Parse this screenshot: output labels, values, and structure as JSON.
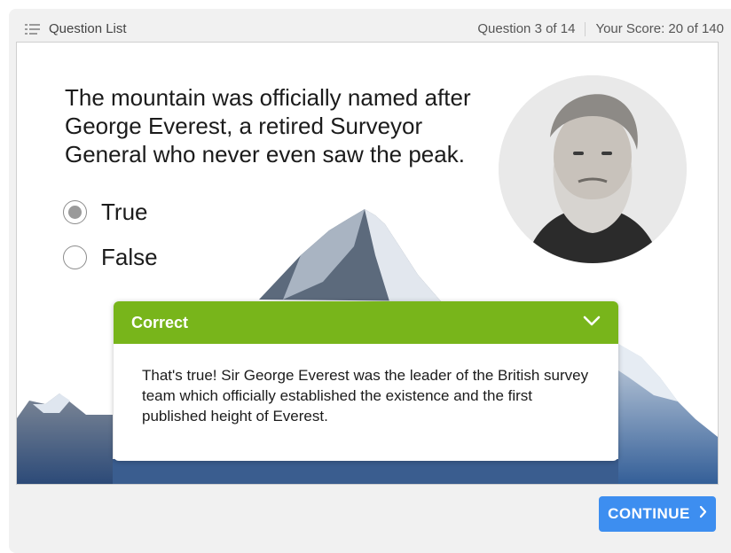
{
  "topbar": {
    "question_list_icon": "list-icon",
    "question_list_label": "Question List",
    "question_counter": "Question 3 of 14",
    "score": "Your Score: 20 of 140"
  },
  "question": {
    "text": "The mountain was officially named after George Everest, a retired Surveyor General who never even saw the peak.",
    "options": [
      {
        "label": "True",
        "selected": true
      },
      {
        "label": "False",
        "selected": false
      }
    ]
  },
  "feedback": {
    "title": "Correct",
    "toggle_icon": "chevron-down-icon",
    "body": "That's true! Sir George Everest was the leader of the British survey team which officially established the existence and the first published height of Everest.",
    "header_color": "#78b51b"
  },
  "continue_button": {
    "label": "CONTINUE",
    "icon": "chevron-right-icon",
    "color": "#3d8ef0"
  }
}
